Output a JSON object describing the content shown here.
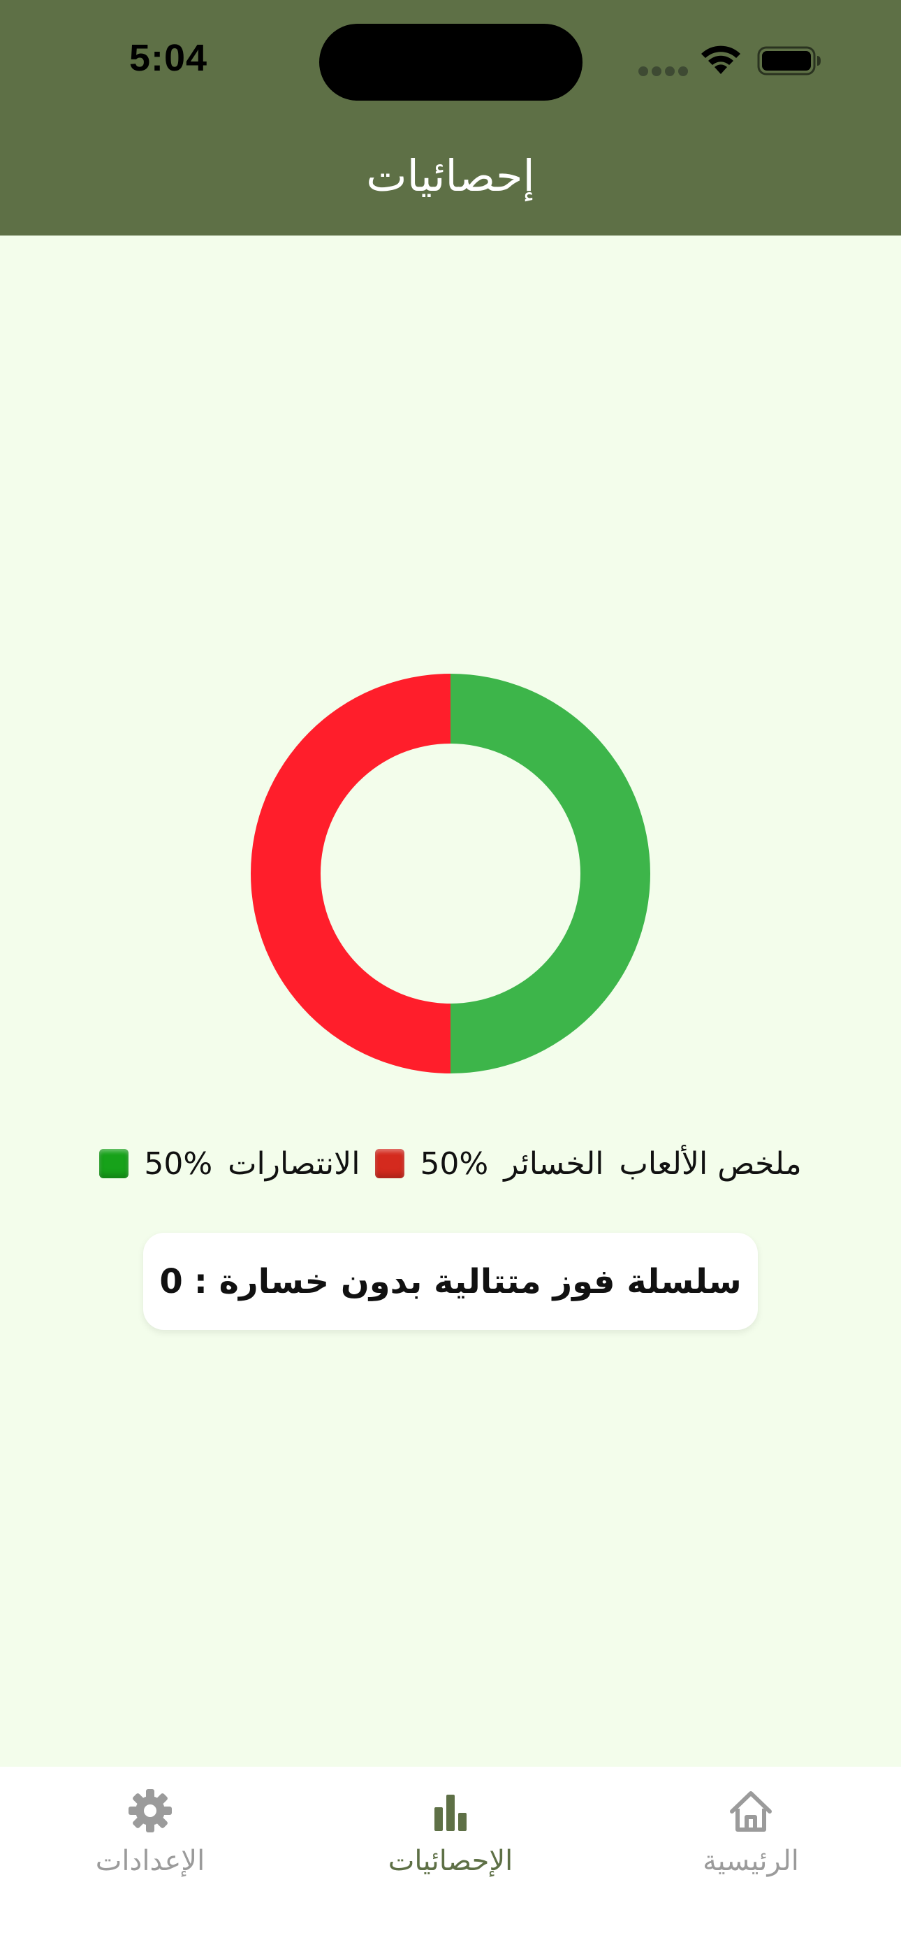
{
  "status_bar": {
    "time": "5:04"
  },
  "header": {
    "title": "إحصائيات"
  },
  "chart_data": {
    "type": "pie",
    "style": "donut",
    "categories": [
      "الانتصارات",
      "الخسائر"
    ],
    "values": [
      50,
      50
    ],
    "colors": [
      "#3DB54A",
      "#FF1E2B"
    ],
    "start_angle": "top",
    "direction": "clockwise"
  },
  "legend": {
    "summary_label": "ملخص الألعاب",
    "losses_label": "الخسائر",
    "losses_percent": "50%",
    "losses_color": "#D42A1E",
    "wins_label": "الانتصارات",
    "wins_percent": "50%",
    "wins_color": "#17A21A"
  },
  "streak": {
    "label": "سلسلة فوز متتالية بدون خسارة :",
    "value": "0"
  },
  "tabbar": {
    "tabs": [
      {
        "label": "الإعدادات",
        "icon": "gear-icon",
        "active": false
      },
      {
        "label": "الإحصائيات",
        "icon": "bar-chart-icon",
        "active": true
      },
      {
        "label": "الرئيسية",
        "icon": "home-icon",
        "active": false
      }
    ],
    "active_color": "#5E7046",
    "inactive_color": "#9B9B9B"
  },
  "colors": {
    "header_bg": "#5E7046",
    "page_bg": "#F3FDEB",
    "card_bg": "#FFFFFF"
  }
}
